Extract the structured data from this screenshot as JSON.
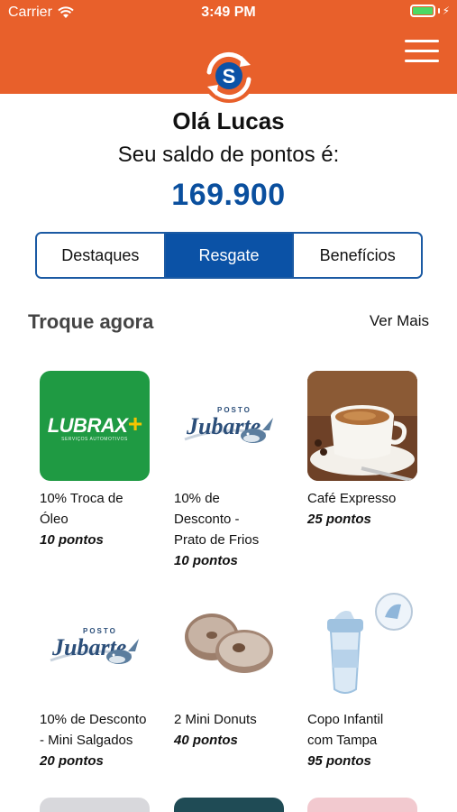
{
  "status_bar": {
    "carrier": "Carrier",
    "time": "3:49 PM",
    "battery_level": 1.0
  },
  "header": {
    "logo_letter": "S",
    "menu_icon": "hamburger-icon",
    "color": "#e8602b"
  },
  "greeting": "Olá Lucas",
  "balance": {
    "label": "Seu saldo de pontos é:",
    "value": "169.900"
  },
  "tabs": [
    {
      "label": "Destaques",
      "active": false
    },
    {
      "label": "Resgate",
      "active": true
    },
    {
      "label": "Benefícios",
      "active": false
    }
  ],
  "section": {
    "title": "Troque agora",
    "see_more": "Ver Mais"
  },
  "products": [
    {
      "name": "10% Troca de Óleo",
      "points": "10 pontos",
      "image": "lubrax-logo",
      "logo_text": "LUBRAX",
      "logo_plus": "+",
      "logo_sub": "SERVIÇOS AUTOMOTIVOS"
    },
    {
      "name": "10% de Desconto - Prato de Frios",
      "points": "10 pontos",
      "image": "jubarte-logo",
      "logo_text": "Jubarte",
      "logo_sub": "POSTO"
    },
    {
      "name": "Café Expresso",
      "points": "25 pontos",
      "image": "coffee-cup-photo"
    },
    {
      "name": "10% de Desconto - Mini Salgados",
      "points": "20 pontos",
      "image": "jubarte-logo",
      "logo_text": "Jubarte",
      "logo_sub": "POSTO"
    },
    {
      "name": "2 Mini Donuts",
      "points": "40 pontos",
      "image": "donuts-photo"
    },
    {
      "name": "Copo Infantil com Tampa",
      "points": "95 pontos",
      "image": "sippy-cup-photo"
    }
  ],
  "colors": {
    "brand_orange": "#e8602b",
    "brand_blue": "#0b52a6",
    "lubrax_green": "#1f9a43"
  }
}
